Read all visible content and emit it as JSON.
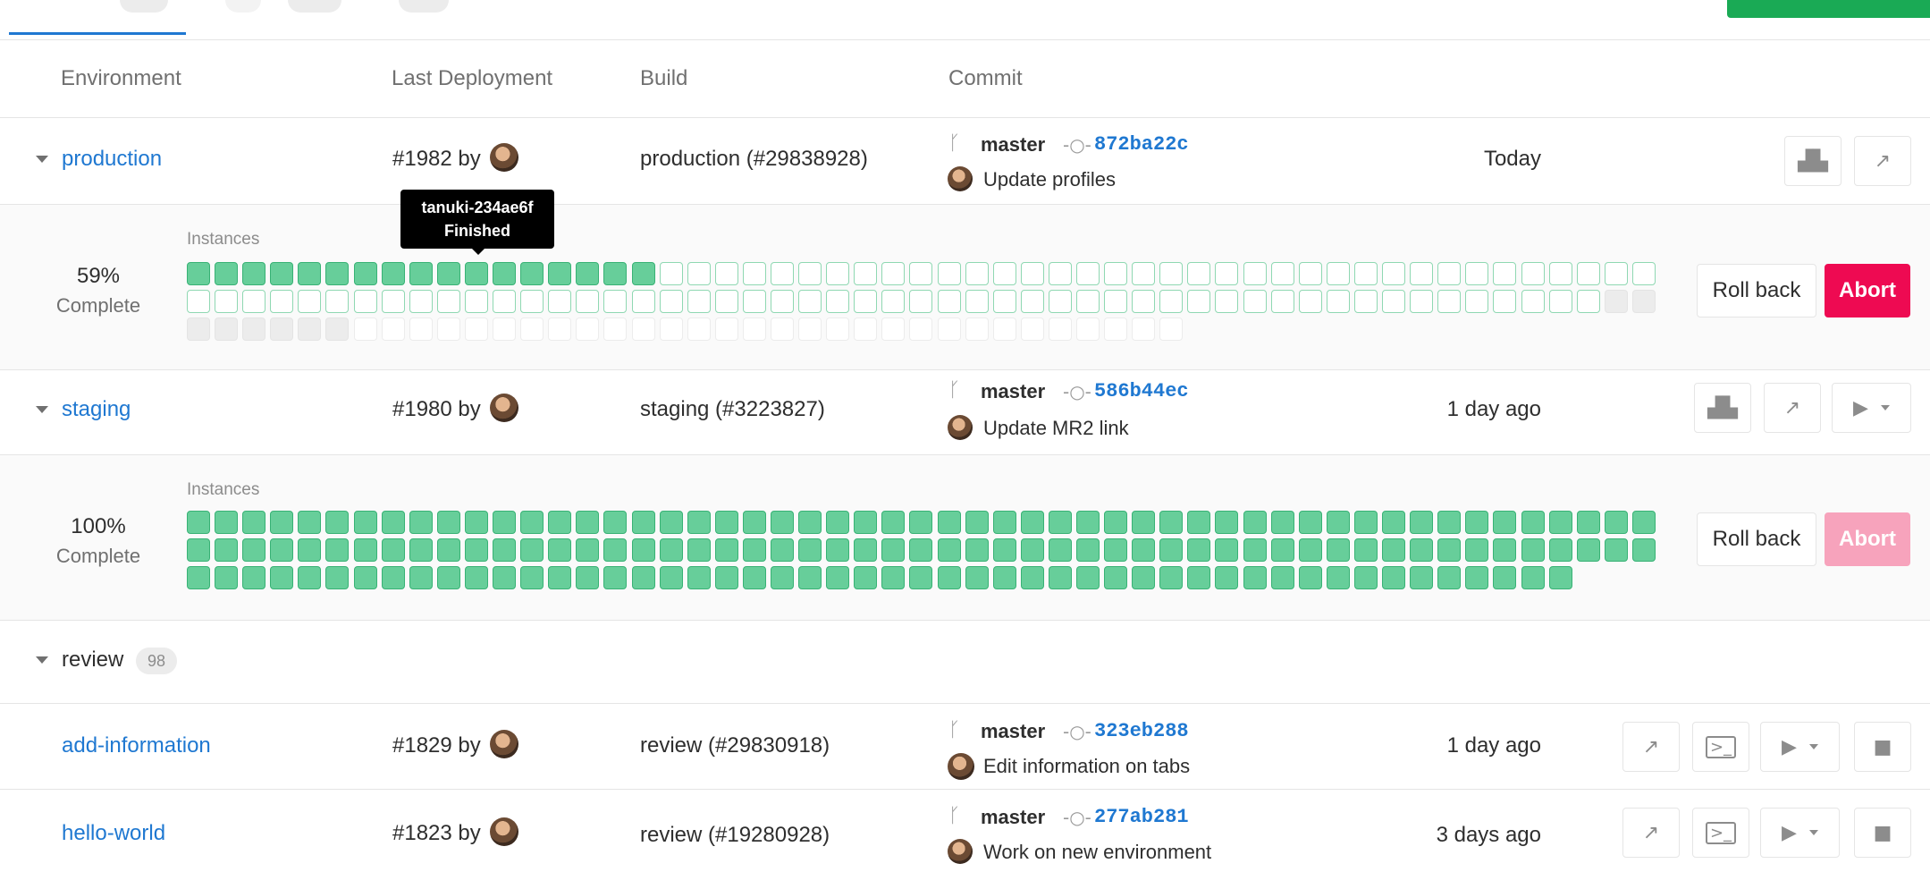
{
  "columns": {
    "environment": "Environment",
    "last_deployment": "Last Deployment",
    "build": "Build",
    "commit": "Commit"
  },
  "rows": {
    "production": {
      "name": "production",
      "deployment": "#1982 by",
      "build": "production (#29838928)",
      "branch": "master",
      "sha": "872ba22c",
      "message": "Update profiles",
      "time": "Today"
    },
    "staging": {
      "name": "staging",
      "deployment": "#1980 by",
      "build": "staging (#3223827)",
      "branch": "master",
      "sha": "586b44ec",
      "message": "Update MR2 link",
      "time": "1 day ago"
    },
    "review_group": {
      "name": "review",
      "count": "98"
    },
    "add_information": {
      "name": "add-information",
      "deployment": "#1829 by",
      "build": "review (#29830918)",
      "branch": "master",
      "sha": "323eb288",
      "message": "Edit information on tabs",
      "time": "1 day ago"
    },
    "hello_world": {
      "name": "hello-world",
      "deployment": "#1823 by",
      "build": "review (#19280928)",
      "branch": "master",
      "sha": "277ab281",
      "message": "Work on new environment",
      "time": "3 days ago"
    }
  },
  "production_panel": {
    "instances_label": "Instances",
    "percent": "59%",
    "complete_label": "Complete",
    "rollback_label": "Roll back",
    "abort_label": "Abort",
    "grid": {
      "done": 17,
      "pending": 87,
      "empty": 8,
      "blank": 30
    }
  },
  "staging_panel": {
    "instances_label": "Instances",
    "percent": "100%",
    "complete_label": "Complete",
    "rollback_label": "Roll back",
    "abort_label": "Abort",
    "grid": {
      "done": 156,
      "pending": 0,
      "empty": 0,
      "blank": 0
    }
  },
  "tooltip": {
    "title": "tanuki-234ae6f",
    "status": "Finished"
  },
  "icons": {
    "monitoring": "area-chart-icon",
    "external": "external-link-icon",
    "deploy": "play-icon",
    "terminal": "terminal-icon",
    "stop": "stop-icon",
    "branch": "branch-icon",
    "commit": "commit-icon"
  },
  "colors": {
    "link": "#1f78d1",
    "instance_done": "#67ce9a",
    "abort_active": "#ee0a52",
    "abort_disabled": "#f7a3bc"
  }
}
